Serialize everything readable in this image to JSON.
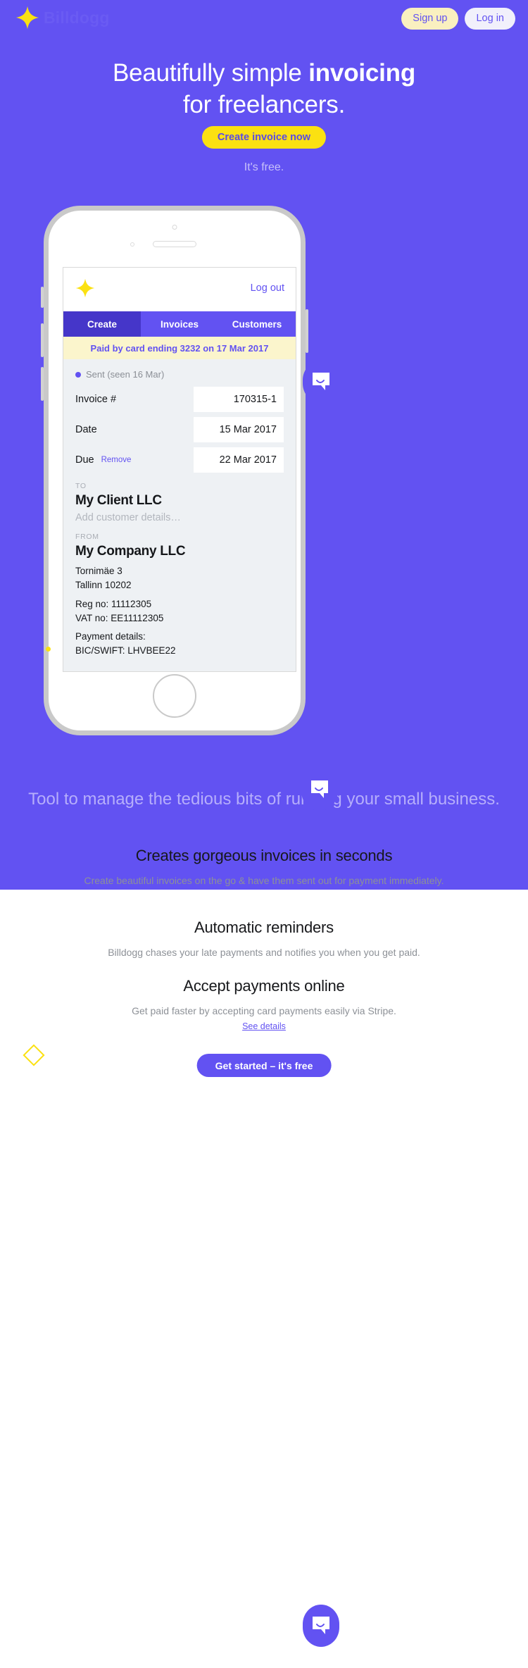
{
  "colors": {
    "brand_purple": "#6252f2",
    "brand_purple_dark": "#4536c9",
    "brand_yellow": "#fbe111",
    "pale_yellow": "#fbf5cc",
    "lead_purple": "#b6aefb"
  },
  "topnav": {
    "brand_name": "Billdogg",
    "logo_icon": "four-point-star-icon",
    "signup_label": "Sign up",
    "login_label": "Log in"
  },
  "hero": {
    "title_part1": "Beautifully simple ",
    "title_strong": "invoicing",
    "title_part2": "for freelancers.",
    "cta_label": "Create invoice now",
    "subtext": "It's free."
  },
  "app": {
    "logo_icon": "four-point-star-icon",
    "logout_label": "Log out",
    "tabs": [
      {
        "label": "Create",
        "active": true
      },
      {
        "label": "Invoices",
        "active": false
      },
      {
        "label": "Customers",
        "active": false
      }
    ],
    "banner": "Paid by card ending 3232 on 17 Mar 2017",
    "status": "Sent (seen 16 Mar)",
    "fields": [
      {
        "label": "Invoice #",
        "value": "170315-1",
        "action": ""
      },
      {
        "label": "Date",
        "value": "15 Mar 2017",
        "action": ""
      },
      {
        "label": "Due",
        "value": "22 Mar 2017",
        "action": "Remove"
      }
    ],
    "to": {
      "section_label": "TO",
      "name": "My Client LLC",
      "placeholder": "Add customer details…"
    },
    "from": {
      "section_label": "FROM",
      "name": "My Company LLC",
      "address_line1": "Tornimäe 3",
      "address_line2": "Tallinn 10202",
      "reg_no": "Reg no: 11112305",
      "vat_no": "VAT no: EE11112305",
      "payment_details_label": "Payment details:",
      "bic_swift": "BIC/SWIFT: LHVBEE22"
    }
  },
  "lead": "Tool to manage the tedious bits of running your small business.",
  "features": [
    {
      "title": "Creates gorgeous invoices in seconds",
      "body": "Create beautiful invoices on the go & have them sent out for payment immediately."
    },
    {
      "title": "Automatic reminders",
      "body": "Billdogg chases your late payments and notifies you when you get paid."
    },
    {
      "title": "Accept payments online",
      "body": "Get paid faster by accepting card payments easily via Stripe."
    }
  ],
  "see_details_label": "See details",
  "get_started_label": "Get started – it's free",
  "chat_widget": {
    "icon": "chat-bubble-icon"
  },
  "decor": {
    "diamond_icon": "diamond-outline-icon"
  }
}
